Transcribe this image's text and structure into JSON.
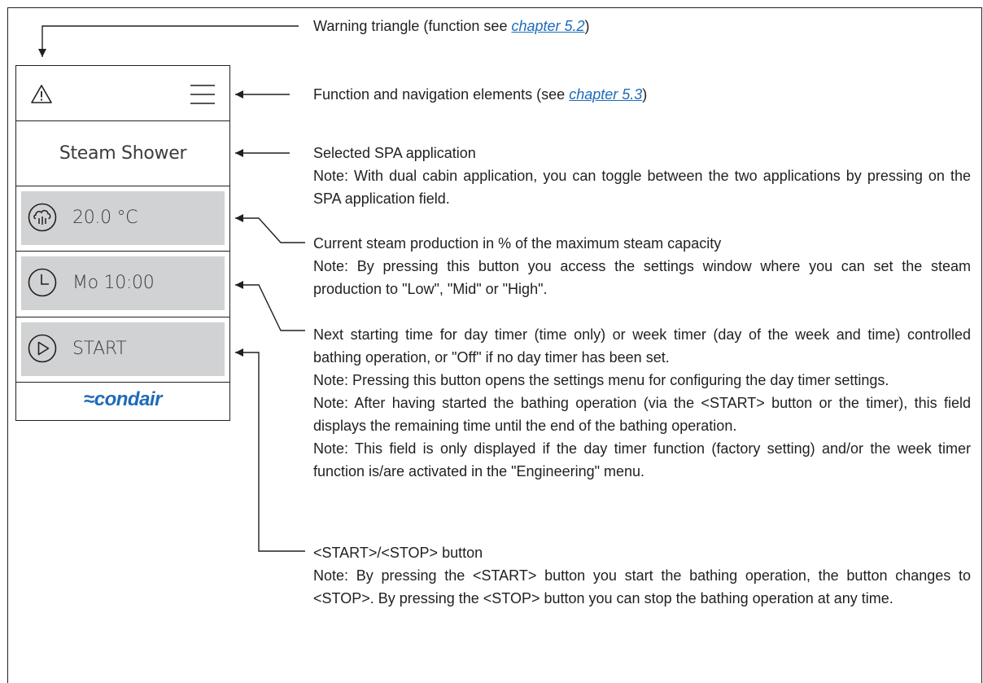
{
  "device": {
    "app_name": "Steam Shower",
    "steam_value": "20.0 °C",
    "timer_value": "Mo 10:00",
    "start_label": "START",
    "logo_text": "condair",
    "logo_wave": "≈",
    "brand_color": "#1e6bb8",
    "button_color": "#d1d2d4"
  },
  "annotations": {
    "warning": {
      "before": "Warning triangle (function see ",
      "link": "chapter 5.2",
      "after": ")"
    },
    "nav": {
      "before": "Function and navigation elements (see ",
      "link": "chapter 5.3",
      "after": ")"
    },
    "app": {
      "title": "Selected SPA application",
      "note": "Note: With dual cabin application, you can toggle between the two applications by pressing on the SPA application field."
    },
    "steam": {
      "title": "Current steam production in % of the maximum steam capacity",
      "note": "Note: By pressing this button you access the settings window where you can set the steam production to \"Low\", \"Mid\" or \"High\"."
    },
    "timer": {
      "title": "Next starting time for day timer (time only) or week timer (day of the week and time) controlled bathing operation, or \"Off\" if no day timer has been set.",
      "note1": "Note: Pressing this button opens the settings menu for configuring the day timer settings.",
      "note2": "Note: After having started the bathing operation (via the <START> button or the timer), this field displays the remaining time until the end of the bathing operation.",
      "note3": "Note: This field is only displayed if the day timer function (factory setting) and/or the week timer function is/are activated in the \"Engineering\" menu."
    },
    "start": {
      "title": "<START>/<STOP> button",
      "note": "Note: By pressing the <START> button you start the bathing operation, the button changes to <STOP>. By pressing the <STOP> button you can stop the bathing operation at any time."
    }
  }
}
